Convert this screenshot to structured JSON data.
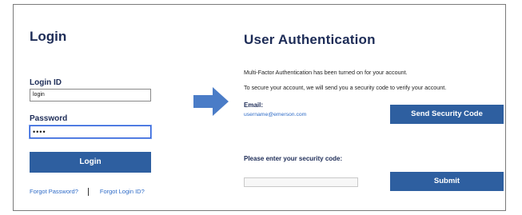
{
  "login_panel": {
    "title": "Login",
    "login_id_label": "Login ID",
    "login_id_value": "login",
    "password_label": "Password",
    "password_value": "••••",
    "login_button": "Login",
    "forgot_password": "Forgot Password?",
    "forgot_login_id": "Forgot Login ID?"
  },
  "arrow": {
    "icon": "right-arrow-icon",
    "color": "#4a7cc7"
  },
  "auth_panel": {
    "title": "User Authentication",
    "message1": "Multi-Factor Authentication has been turned on for your account.",
    "message2": "To secure your account, we will send you a security code to verify your account.",
    "email_label": "Email:",
    "email_value": "username@emerson.com",
    "send_button": "Send Security Code",
    "code_label": "Please enter your security code:",
    "code_value": "",
    "submit_button": "Submit"
  },
  "colors": {
    "button": "#2e5fa0",
    "heading": "#1d2c57",
    "link": "#2e6bc7"
  }
}
